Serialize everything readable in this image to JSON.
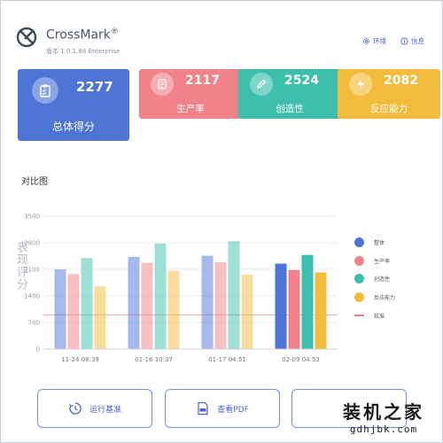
{
  "app": {
    "name": "CrossMark",
    "registered": "®",
    "version": "版本 1.0.1.88 Enterprise"
  },
  "header": {
    "env_label": "环境",
    "info_label": "信息"
  },
  "cards": [
    {
      "value": "2277",
      "label": "总体得分",
      "icon": "clipboard-icon"
    },
    {
      "value": "2117",
      "label": "生产率",
      "icon": "document-icon"
    },
    {
      "value": "2524",
      "label": "创造性",
      "icon": "pen-icon"
    },
    {
      "value": "2082",
      "label": "反应能力",
      "icon": "bolt-icon"
    }
  ],
  "section_title": "对比图",
  "chart_data": {
    "type": "bar",
    "ylabel": "表现评分",
    "ylim": [
      0,
      3500
    ],
    "yticks": [
      "0",
      "700",
      "1400",
      "2100",
      "2800",
      "3500"
    ],
    "categories": [
      "11-24 08:39",
      "01-16 10:37",
      "01-17 04:51",
      "02-09 04:53"
    ],
    "series": [
      {
        "name": "整体",
        "color": "#4e74d6",
        "values": [
          2100,
          2430,
          2460,
          2250
        ]
      },
      {
        "name": "生产率",
        "color": "#f2828a",
        "values": [
          1980,
          2270,
          2290,
          2080
        ]
      },
      {
        "name": "创造性",
        "color": "#3dbfae",
        "values": [
          2400,
          2780,
          2840,
          2480
        ]
      },
      {
        "name": "反应能力",
        "color": "#f4bc3c",
        "values": [
          1650,
          2060,
          1960,
          2020
        ]
      }
    ],
    "highlight_index": 3,
    "baseline": {
      "name": "较准",
      "color": "#f08080",
      "value": 900
    }
  },
  "buttons": {
    "run": "运行基准",
    "pdf": "查看PDF"
  },
  "watermark": {
    "main": "装机之家",
    "url": "gdhjbk.com"
  }
}
